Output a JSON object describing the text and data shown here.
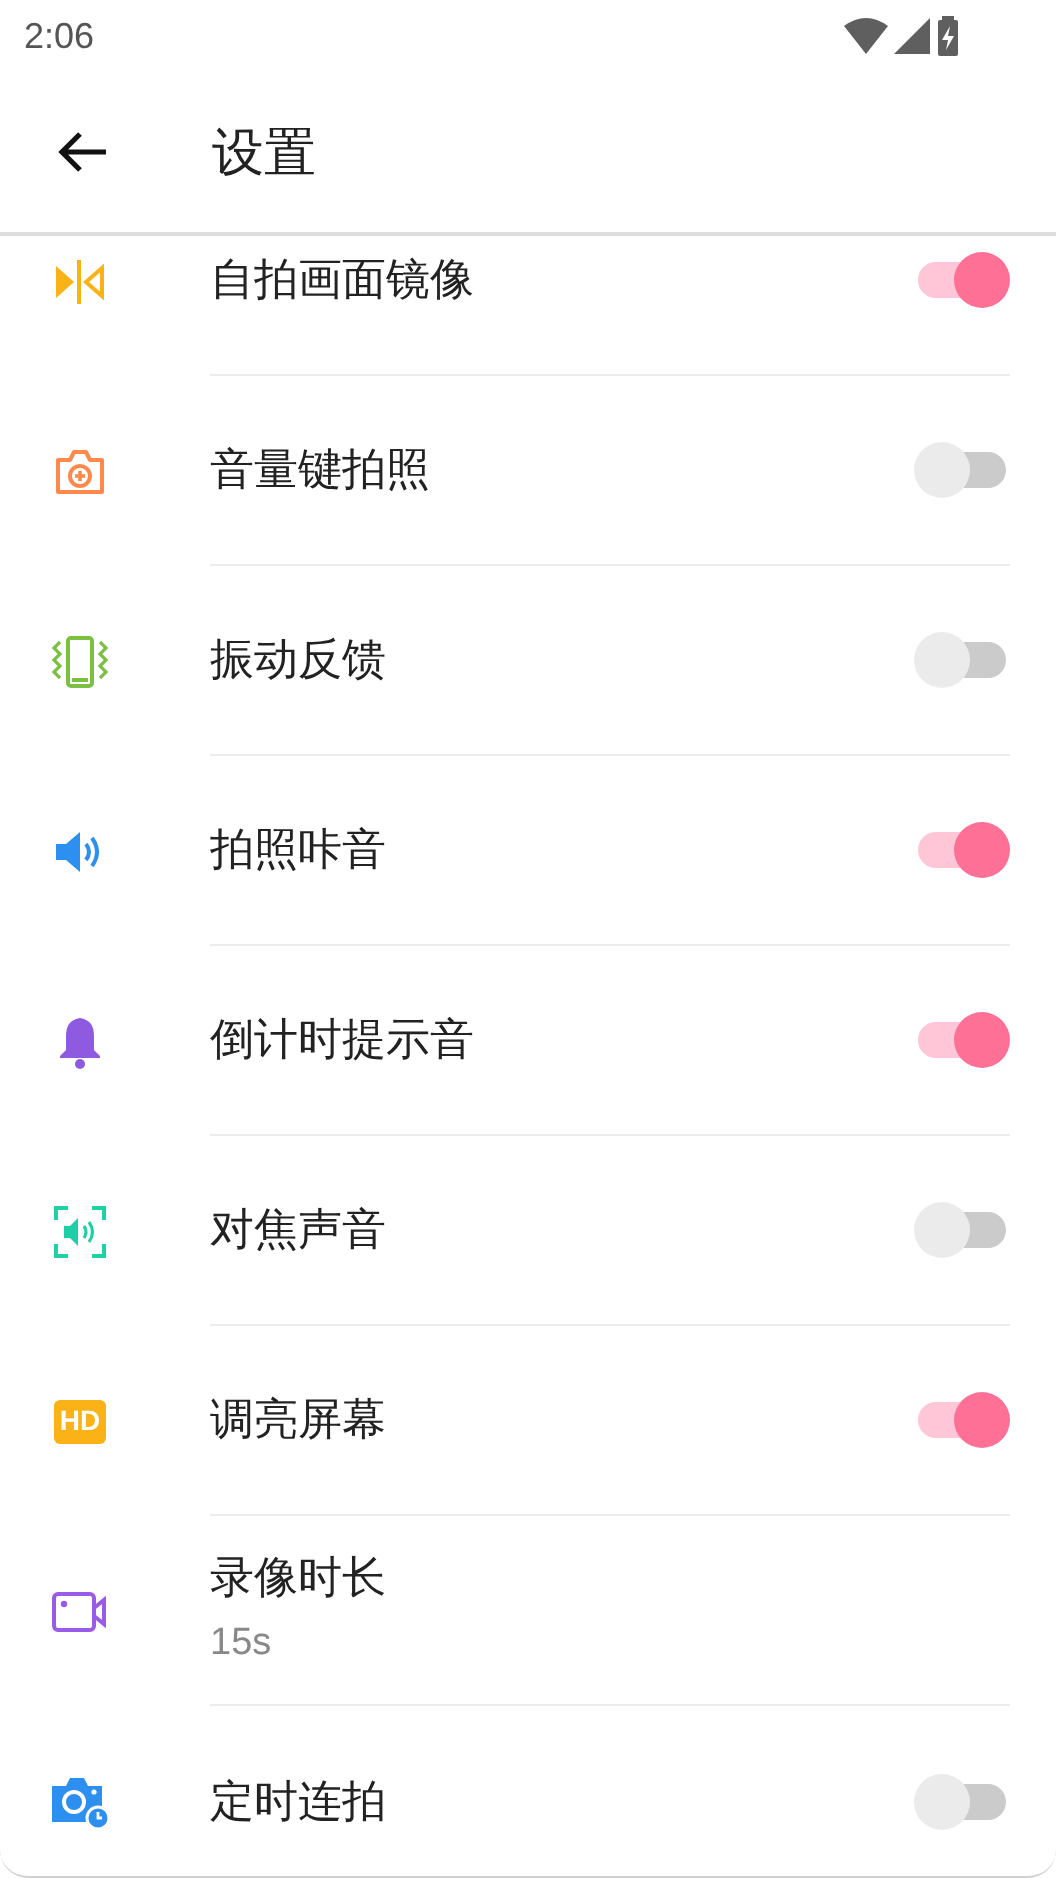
{
  "status_bar": {
    "time": "2:06"
  },
  "app_bar": {
    "title": "设置"
  },
  "settings": [
    {
      "kind": "toggle",
      "label": "自拍画面镜像",
      "on": true
    },
    {
      "kind": "toggle",
      "label": "音量键拍照",
      "on": false
    },
    {
      "kind": "toggle",
      "label": "振动反馈",
      "on": false
    },
    {
      "kind": "toggle",
      "label": "拍照咔音",
      "on": true
    },
    {
      "kind": "toggle",
      "label": "倒计时提示音",
      "on": true
    },
    {
      "kind": "toggle",
      "label": "对焦声音",
      "on": false
    },
    {
      "kind": "toggle",
      "badge": "HD",
      "label": "调亮屏幕",
      "on": true
    },
    {
      "kind": "value",
      "label": "录像时长",
      "value": "15s"
    },
    {
      "kind": "toggle",
      "label": "定时连拍",
      "on": false
    }
  ]
}
